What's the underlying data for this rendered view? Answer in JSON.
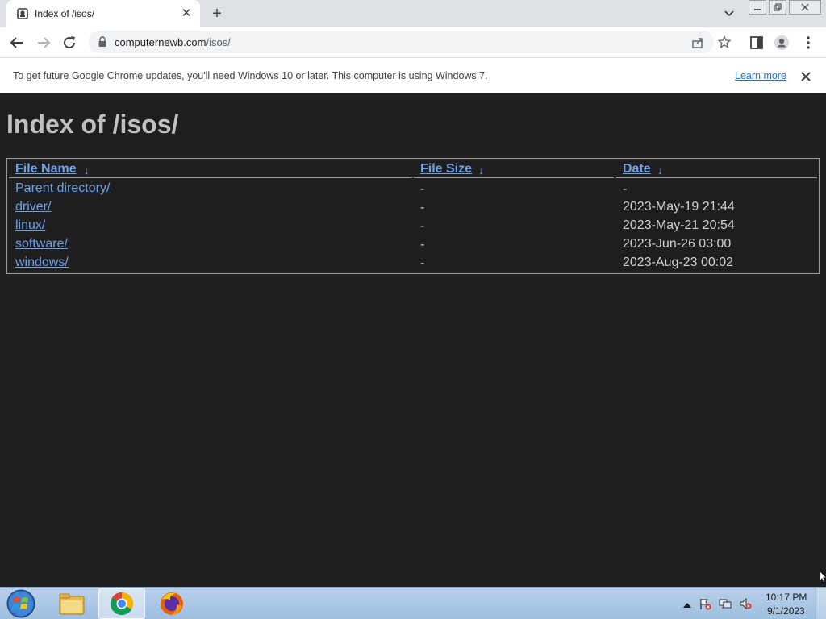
{
  "browser": {
    "tab_title": "Index of /isos/",
    "tab_close": "✕",
    "new_tab": "+",
    "url_host": "computernewb.com",
    "url_path": "/isos/"
  },
  "infobar": {
    "message": "To get future Google Chrome updates, you'll need Windows 10 or later. This computer is using Windows 7.",
    "learn_more": "Learn more"
  },
  "page": {
    "title": "Index of /isos/",
    "columns": [
      "File Name",
      "File Size",
      "Date"
    ],
    "sort_arrow": "↓",
    "rows": [
      {
        "name": "Parent directory/",
        "size": "-",
        "date": "-"
      },
      {
        "name": "driver/",
        "size": "-",
        "date": "2023-May-19 21:44"
      },
      {
        "name": "linux/",
        "size": "-",
        "date": "2023-May-21 20:54"
      },
      {
        "name": "software/",
        "size": "-",
        "date": "2023-Jun-26 03:00"
      },
      {
        "name": "windows/",
        "size": "-",
        "date": "2023-Aug-23 00:02"
      }
    ]
  },
  "taskbar": {
    "apps": [
      "file-explorer",
      "chrome",
      "firefox"
    ],
    "clock_time": "10:17 PM",
    "clock_date": "9/1/2023"
  },
  "colors": {
    "page_background": "#1e1e1e",
    "link": "#6ea0e6",
    "title": "#c0c0c0"
  }
}
